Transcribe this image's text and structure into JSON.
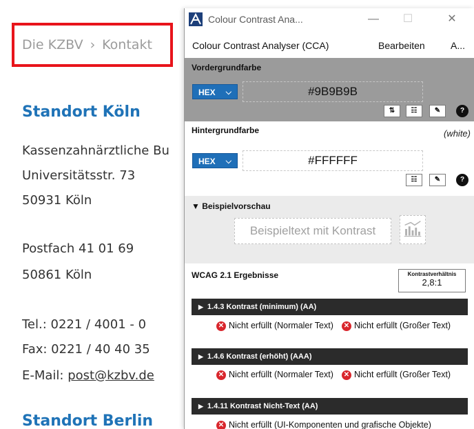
{
  "site": {
    "breadcrumb": {
      "parent": "Die KZBV",
      "separator": "›",
      "current": "Kontakt"
    },
    "locations": [
      {
        "heading": "Standort Köln",
        "address": [
          "Kassenzahnärztliche Bu",
          "Universitätsstr. 73",
          "50931 Köln"
        ],
        "postbox": [
          "Postfach 41 01 69",
          "50861 Köln"
        ],
        "tel": "Tel.: 0221 / 4001 - 0",
        "fax": "Fax: 0221 / 40 40 35",
        "email_label": "E-Mail: ",
        "email": "post@kzbv.de"
      },
      {
        "heading": "Standort Berlin"
      }
    ]
  },
  "cca": {
    "window_title": "Colour Contrast Ana...",
    "window_controls": {
      "minimize": "—",
      "maximize": "☐",
      "close": "✕"
    },
    "menu": [
      "Colour Contrast Analyser (CCA)",
      "Bearbeiten",
      "A..."
    ],
    "foreground": {
      "label": "Vordergrundfarbe",
      "format": "HEX",
      "value": "#9B9B9B",
      "color": "#9b9b9b",
      "tools": [
        "swap-icon",
        "sliders-icon",
        "eyedropper-icon",
        "help-icon"
      ]
    },
    "background": {
      "label": "Hintergrundfarbe",
      "color_name": "(white)",
      "format": "HEX",
      "value": "#FFFFFF",
      "color": "#ffffff",
      "tools": [
        "sliders-icon",
        "eyedropper-icon",
        "help-icon"
      ]
    },
    "preview": {
      "toggle": "▼",
      "label": "Beispielvorschau",
      "sample_text": "Beispieltext mit Kontrast",
      "sample_color": "#a0a0a0"
    },
    "results": {
      "label": "WCAG 2.1 Ergebnisse",
      "ratio_label": "Kontrastverhältnis",
      "ratio_value": "2,8:1",
      "criteria": [
        {
          "title": "1.4.3 Kontrast (minimum) (AA)",
          "results": [
            {
              "text": "Nicht erfüllt (Normaler Text)",
              "status": "fail"
            },
            {
              "text": "Nicht erfüllt (Großer Text)",
              "status": "fail"
            }
          ]
        },
        {
          "title": "1.4.6 Kontrast (erhöht) (AAA)",
          "results": [
            {
              "text": "Nicht erfüllt (Normaler Text)",
              "status": "fail"
            },
            {
              "text": "Nicht erfüllt (Großer Text)",
              "status": "fail"
            }
          ]
        },
        {
          "title": "1.4.11 Kontrast Nicht-Text (AA)",
          "results": [
            {
              "text": "Nicht erfüllt (UI-Komponenten und grafische Objekte)",
              "status": "fail"
            }
          ]
        }
      ]
    },
    "colors": {
      "accent": "#1f6fb8",
      "fail": "#d9262c",
      "bar": "#2b2b2b",
      "link": "#1f73b7",
      "highlight": "#e8141b"
    }
  }
}
